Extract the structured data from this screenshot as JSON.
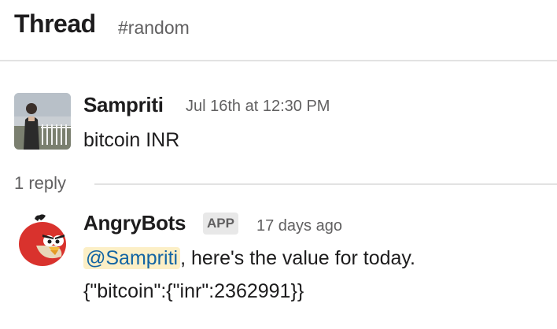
{
  "header": {
    "title": "Thread",
    "channel": "#random"
  },
  "parent_message": {
    "author": "Sampriti",
    "timestamp": "Jul 16th at 12:30 PM",
    "text": "bitcoin INR"
  },
  "replies": {
    "count_label": "1 reply"
  },
  "reply_message": {
    "author": "AngryBots",
    "badge": "APP",
    "timestamp": "17 days ago",
    "mention": "@Sampriti",
    "text_after_mention": ", here's the value for today.",
    "payload": "{\"bitcoin\":{\"inr\":2362991}}"
  },
  "icons": {
    "user_avatar": "user-avatar-photo",
    "bot_avatar": "angry-bird-avatar"
  },
  "colors": {
    "mention_bg": "#fcefc6",
    "mention_fg": "#1264a3",
    "bot_red": "#d9322d"
  }
}
